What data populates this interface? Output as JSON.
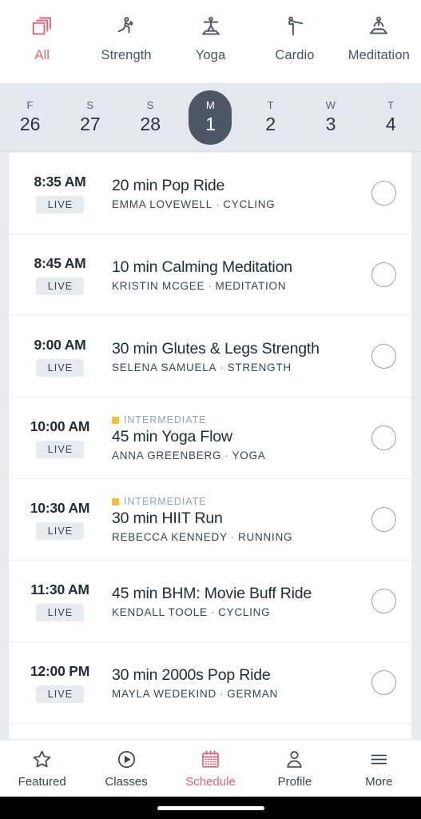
{
  "colors": {
    "accent": "#e4606d",
    "selected_day_pill": "#4d5664",
    "level_intermediate": "#f5c033",
    "date_strip_bg": "#e4e8ee",
    "page_bg": "#e9ebef",
    "text_primary": "#252b36"
  },
  "categories": [
    {
      "label": "All",
      "icon": "stacked-squares-icon",
      "active": true
    },
    {
      "label": "Strength",
      "icon": "strength-lunge-icon",
      "active": false
    },
    {
      "label": "Yoga",
      "icon": "yoga-warrior-icon",
      "active": false
    },
    {
      "label": "Cardio",
      "icon": "cardio-kick-icon",
      "active": false
    },
    {
      "label": "Meditation",
      "icon": "meditation-lotus-icon",
      "active": false
    }
  ],
  "dates": [
    {
      "dow": "F",
      "num": "26",
      "selected": false
    },
    {
      "dow": "S",
      "num": "27",
      "selected": false
    },
    {
      "dow": "S",
      "num": "28",
      "selected": false
    },
    {
      "dow": "M",
      "num": "1",
      "selected": true
    },
    {
      "dow": "T",
      "num": "2",
      "selected": false
    },
    {
      "dow": "W",
      "num": "3",
      "selected": false
    },
    {
      "dow": "T",
      "num": "4",
      "selected": false
    }
  ],
  "classes": [
    {
      "time": "8:35 AM",
      "badge": "LIVE",
      "level": null,
      "title": "20 min Pop Ride",
      "instructor": "EMMA LOVEWELL",
      "separator": "·",
      "discipline": "CYCLING"
    },
    {
      "time": "8:45 AM",
      "badge": "LIVE",
      "level": null,
      "title": "10 min Calming Meditation",
      "instructor": "KRISTIN MCGEE",
      "separator": "·",
      "discipline": "MEDITATION"
    },
    {
      "time": "9:00 AM",
      "badge": "LIVE",
      "level": null,
      "title": "30 min Glutes & Legs Strength",
      "instructor": "SELENA SAMUELA",
      "separator": "·",
      "discipline": "STRENGTH"
    },
    {
      "time": "10:00 AM",
      "badge": "LIVE",
      "level": "INTERMEDIATE",
      "title": "45 min Yoga Flow",
      "instructor": "ANNA GREENBERG",
      "separator": "·",
      "discipline": "YOGA"
    },
    {
      "time": "10:30 AM",
      "badge": "LIVE",
      "level": "INTERMEDIATE",
      "title": "30 min HIIT Run",
      "instructor": "REBECCA KENNEDY",
      "separator": "·",
      "discipline": "RUNNING"
    },
    {
      "time": "11:30 AM",
      "badge": "LIVE",
      "level": null,
      "title": "45 min BHM: Movie Buff Ride",
      "instructor": "KENDALL TOOLE",
      "separator": "·",
      "discipline": "CYCLING"
    },
    {
      "time": "12:00 PM",
      "badge": "LIVE",
      "level": null,
      "title": "30 min 2000s Pop Ride",
      "instructor": "MAYLA WEDEKIND",
      "separator": "·",
      "discipline": "GERMAN"
    }
  ],
  "tabbar": [
    {
      "label": "Featured",
      "icon": "star-icon",
      "active": false
    },
    {
      "label": "Classes",
      "icon": "play-circle-icon",
      "active": false
    },
    {
      "label": "Schedule",
      "icon": "calendar-icon",
      "active": true
    },
    {
      "label": "Profile",
      "icon": "person-icon",
      "active": false
    },
    {
      "label": "More",
      "icon": "hamburger-icon",
      "active": false
    }
  ]
}
